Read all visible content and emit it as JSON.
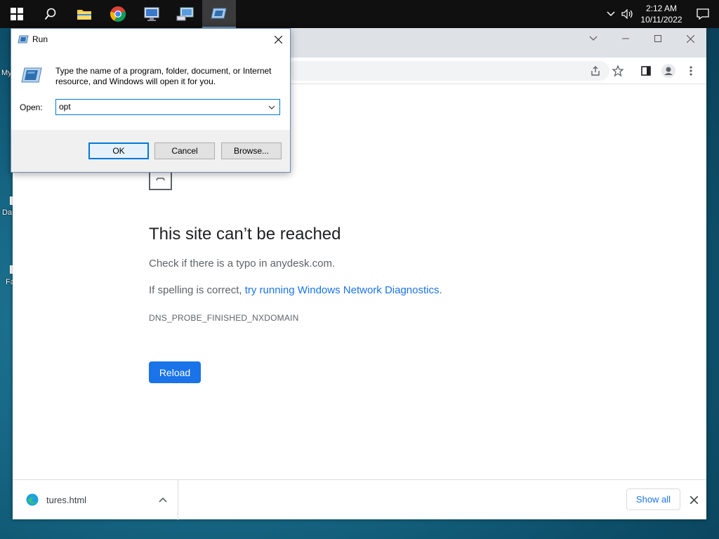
{
  "taskbar": {
    "apps": [
      {
        "name": "start-button"
      },
      {
        "name": "search-button"
      },
      {
        "name": "file-explorer"
      },
      {
        "name": "chrome"
      },
      {
        "name": "remote-desktop"
      },
      {
        "name": "network-tool"
      },
      {
        "name": "run-app"
      }
    ],
    "clock_time": "2:12 AM",
    "clock_date": "10/11/2022"
  },
  "desktop": {
    "fragments": [
      "My",
      "Da",
      "Fa"
    ]
  },
  "browser": {
    "error": {
      "title": "This site can’t be reached",
      "line1": "Check if there is a typo in anydesk.com.",
      "line2_prefix": "If spelling is correct, ",
      "line2_link": "try running Windows Network Diagnostics",
      "line2_suffix": ".",
      "code": "DNS_PROBE_FINISHED_NXDOMAIN",
      "reload_label": "Reload"
    },
    "downloads": {
      "item_name": "tures.html",
      "show_all_label": "Show all"
    }
  },
  "run_dialog": {
    "title": "Run",
    "description": "Type the name of a program, folder, document, or Internet resource, and Windows will open it for you.",
    "open_label": "Open:",
    "input_value": "opt",
    "ok_label": "OK",
    "cancel_label": "Cancel",
    "browse_label": "Browse..."
  },
  "colors": {
    "accent": "#1a73e8",
    "windows_blue": "#0078d7",
    "taskbar": "#101010"
  }
}
